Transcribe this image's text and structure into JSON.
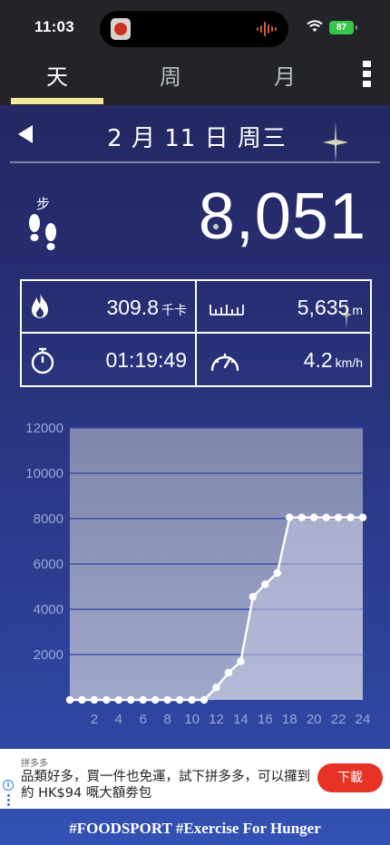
{
  "status_bar": {
    "time": "11:03",
    "battery": "87",
    "battery_color": "#37c649"
  },
  "tabs": [
    {
      "label": "天",
      "active": true
    },
    {
      "label": "周",
      "active": false
    },
    {
      "label": "月",
      "active": false
    }
  ],
  "date_nav": {
    "title": "2 月 11 日 周三"
  },
  "steps": {
    "label": "步",
    "value": "8,051"
  },
  "stats": {
    "calories": {
      "value": "309.8",
      "unit": "千卡"
    },
    "distance": {
      "value": "5,635",
      "unit": "m"
    },
    "duration": {
      "value": "01:19:49"
    },
    "speed": {
      "value": "4.2",
      "unit": "km/h"
    }
  },
  "chart_data": {
    "type": "area",
    "x": [
      0,
      1,
      2,
      3,
      4,
      5,
      6,
      7,
      8,
      9,
      10,
      11,
      12,
      13,
      14,
      15,
      16,
      17,
      18,
      19,
      20,
      21,
      22,
      23,
      24
    ],
    "values": [
      0,
      0,
      0,
      0,
      0,
      0,
      0,
      0,
      0,
      0,
      0,
      0,
      550,
      1200,
      1700,
      4550,
      5100,
      5600,
      8050,
      8051,
      8051,
      8051,
      8051,
      8051,
      8051
    ],
    "x_ticks": [
      "2",
      "4",
      "6",
      "8",
      "10",
      "12",
      "14",
      "16",
      "18",
      "20",
      "22",
      "24"
    ],
    "y_ticks": [
      "12000",
      "10000",
      "8000",
      "6000",
      "4000",
      "2000"
    ],
    "ylim": [
      0,
      12000
    ],
    "xlim": [
      0,
      24
    ],
    "grid": true
  },
  "ad": {
    "source": "拼多多",
    "text": "品類好多，買一件也免運，試下拼多多，可以攞到約 HK$94 嘅大額劵包",
    "cta": "下載"
  },
  "footer": {
    "slogan": "#FOODSPORT #Exercise For Hunger"
  }
}
